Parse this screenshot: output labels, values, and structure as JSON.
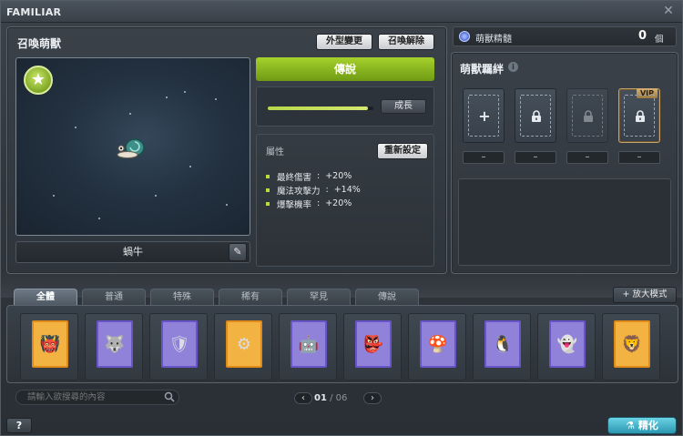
{
  "window": {
    "title": "FAMILIAR",
    "close_glyph": "✕"
  },
  "summon": {
    "title": "召喚萌獸",
    "appearance_button": "外型變更",
    "release_button": "召喚解除",
    "grade_badge_icon": "green-star-badge-icon",
    "familiar_name": "蝸牛",
    "edit_icon": "pencil-icon"
  },
  "grade": {
    "label": "傳說",
    "color": "#8dbd1f"
  },
  "growth": {
    "button": "成長",
    "progress": 0.95
  },
  "attributes": {
    "label": "屬性",
    "reset_button": "重新設定",
    "stats": [
      {
        "name": "最終傷害",
        "sep": ":",
        "value": "+20%"
      },
      {
        "name": "魔法攻擊力",
        "sep": ":",
        "value": "+14%"
      },
      {
        "name": "爆擊機率",
        "sep": ":",
        "value": "+20%"
      }
    ]
  },
  "essence": {
    "label": "萌獸精髓",
    "count": "0",
    "unit": "個"
  },
  "bond": {
    "title": "萌獸羈絆",
    "info_glyph": "i",
    "slots": [
      {
        "glyph": "+",
        "icon": "plus-icon",
        "state": "open",
        "caption": "–"
      },
      {
        "glyph": "🔒",
        "icon": "lock-icon",
        "state": "locked",
        "caption": "–"
      },
      {
        "glyph": "🔒",
        "icon": "lock-icon",
        "state": "disabled",
        "caption": "–"
      },
      {
        "glyph": "🔒",
        "icon": "lock-icon",
        "state": "vip",
        "caption": "–",
        "vip_label": "VIP"
      }
    ]
  },
  "tabs": [
    {
      "label": "全體",
      "active": true
    },
    {
      "label": "普通",
      "active": false
    },
    {
      "label": "特殊",
      "active": false
    },
    {
      "label": "稀有",
      "active": false
    },
    {
      "label": "罕見",
      "active": false
    },
    {
      "label": "傳說",
      "active": false
    }
  ],
  "zoom_button": "+ 放大模式",
  "cards": [
    {
      "icon": "red-monster-card-icon",
      "face": "👹",
      "rarity": "special"
    },
    {
      "icon": "wolf-monster-card-icon",
      "face": "🐺",
      "rarity": "normal"
    },
    {
      "icon": "armored-monster-card-icon",
      "face": "🛡",
      "rarity": "normal"
    },
    {
      "icon": "machine-monster-card-icon",
      "face": "⚙",
      "rarity": "special"
    },
    {
      "icon": "knight-monster-card-icon",
      "face": "🤖",
      "rarity": "normal"
    },
    {
      "icon": "goblin-monster-card-icon",
      "face": "👺",
      "rarity": "normal"
    },
    {
      "icon": "mushroom-monster-card-icon",
      "face": "🍄",
      "rarity": "normal"
    },
    {
      "icon": "penguin-monster-card-icon",
      "face": "🐧",
      "rarity": "normal"
    },
    {
      "icon": "ghost-monster-card-icon",
      "face": "👻",
      "rarity": "normal"
    },
    {
      "icon": "golden-monster-card-icon",
      "face": "🦁",
      "rarity": "special"
    }
  ],
  "search": {
    "placeholder": "請輸入欲搜尋的內容"
  },
  "pager": {
    "prev": "‹",
    "next": "›",
    "current": "01",
    "separator": "/",
    "total": "06"
  },
  "help_button": "?",
  "refine_button": "精化",
  "refine_icon": "flask-icon"
}
